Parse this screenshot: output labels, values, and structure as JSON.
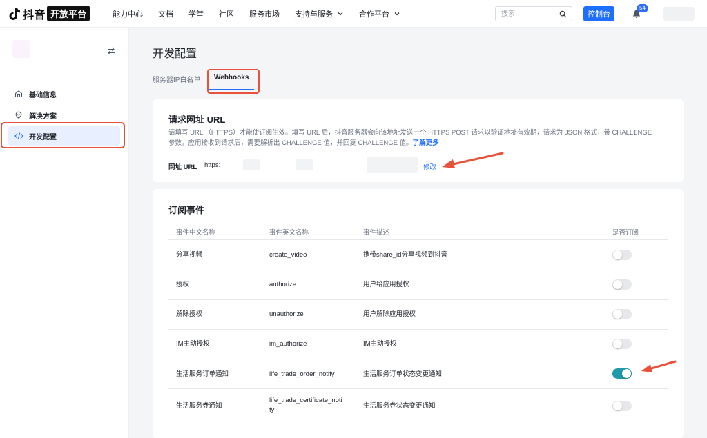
{
  "brand": {
    "name": "抖音",
    "badge": "开放平台"
  },
  "nav": {
    "items": [
      {
        "label": "能力中心"
      },
      {
        "label": "文档"
      },
      {
        "label": "学堂"
      },
      {
        "label": "社区"
      },
      {
        "label": "服务市场"
      },
      {
        "label": "支持与服务"
      },
      {
        "label": "合作平台"
      }
    ],
    "search_placeholder": "搜索",
    "console_label": "控制台",
    "notification_count": "54"
  },
  "sidebar": {
    "items": [
      {
        "label": "基础信息"
      },
      {
        "label": "解决方案"
      },
      {
        "label": "开发配置"
      }
    ]
  },
  "page": {
    "title": "开发配置",
    "tabs": [
      {
        "label": "服务器IP白名单"
      },
      {
        "label": "Webhooks"
      }
    ]
  },
  "url_card": {
    "title": "请求网址 URL",
    "desc_line1": "请填写 URL （HTTPS）才能使订阅生效。填写 URL 后，抖音服务器会向该地址发送一个 HTTPS POST 请求以验证地址有效期，请求为 JSON 格式，带 CHALLENGE",
    "desc_line2": "参数。应用接收到请求后，需要解析出 CHALLENGE 值，并回复 CHALLENGE 值。",
    "learn_more": "了解更多",
    "url_label": "网址 URL",
    "url_value": "https:",
    "modify": "修改"
  },
  "events": {
    "title": "订阅事件",
    "headers": {
      "cn": "事件中文名称",
      "en": "事件英文名称",
      "desc": "事件描述",
      "sub": "是否订阅"
    },
    "rows": [
      {
        "cn": "分享视频",
        "en": "create_video",
        "desc": "携带share_id分享视频到抖音",
        "subscribed": false
      },
      {
        "cn": "授权",
        "en": "authorize",
        "desc": "用户给应用授权",
        "subscribed": false
      },
      {
        "cn": "解除授权",
        "en": "unauthorize",
        "desc": "用户解除应用授权",
        "subscribed": false
      },
      {
        "cn": "IM主动授权",
        "en": "im_authorize",
        "desc": "IM主动授权",
        "subscribed": false
      },
      {
        "cn": "生活服务订单通知",
        "en": "life_trade_order_notify",
        "desc": "生活服务订单状态变更通知",
        "subscribed": true
      },
      {
        "cn": "生活服务券通知",
        "en_line1": "life_trade_certificate_noti",
        "en_line2": "fy",
        "desc": "生活服务券状态变更通知",
        "subscribed": false
      }
    ]
  },
  "colors": {
    "primary": "#1f6fff",
    "toggle_on": "#1e9aa8",
    "annotation": "#e8523a"
  }
}
